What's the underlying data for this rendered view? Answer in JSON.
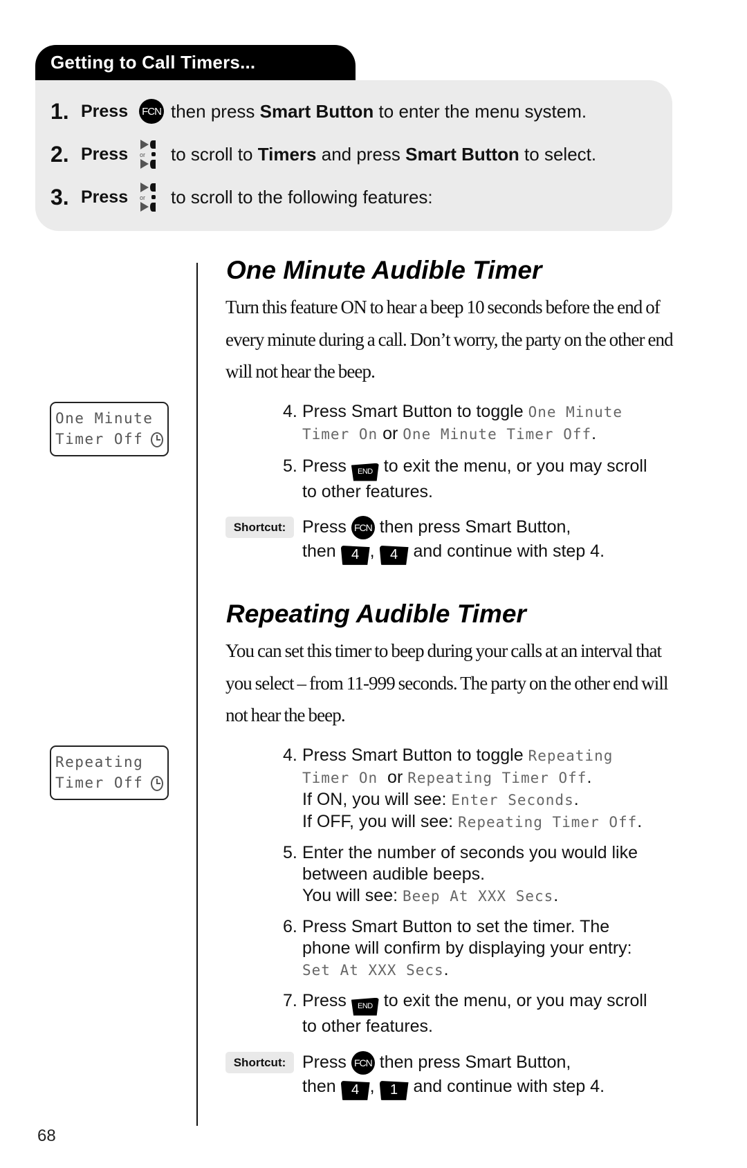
{
  "header": {
    "title": "Getting to Call Timers..."
  },
  "getting_steps": [
    {
      "num": "1.",
      "press": "Press",
      "icon": "fcn-key-icon",
      "icon_label": "FCN",
      "text_before": "then press ",
      "bold1": "Smart Button",
      "text_mid": " to enter the menu system.",
      "bold2": "",
      "text_after": ""
    },
    {
      "num": "2.",
      "press": "Press",
      "icon": "scroll-keys-icon",
      "icon_label": "or",
      "text_before": "to scroll to ",
      "bold1": "Timers",
      "text_mid": " and press ",
      "bold2": "Smart Button",
      "text_after": " to select."
    },
    {
      "num": "3.",
      "press": "Press",
      "icon": "scroll-keys-icon",
      "icon_label": "or",
      "text_before": "to scroll to the following features:",
      "bold1": "",
      "text_mid": "",
      "bold2": "",
      "text_after": ""
    }
  ],
  "sections": [
    {
      "title": "One Minute Audible Timer",
      "paragraph_lines": [
        "Turn this feature ON to hear a beep 10 seconds before the end of",
        "every minute during a call. Don’t worry, the party on the other end",
        "will not hear the beep."
      ],
      "lcd": {
        "line1": "One Minute",
        "line2": "Timer Off",
        "icon": "clock-icon"
      },
      "steps": [
        {
          "num": "4.",
          "line1_text": "Press Smart Button to toggle ",
          "line1_lcd": "One Minute",
          "line2_lcd_a": "Timer On",
          "line2_or": " or ",
          "line2_lcd_b": "One Minute Timer Off",
          "line2_end": "."
        },
        {
          "num": "5.",
          "press": "Press ",
          "key": "END",
          "rest": " to exit the menu, or you may scroll",
          "line2": "to other features."
        }
      ],
      "shortcut": {
        "label": "Shortcut:",
        "press": "Press ",
        "fcn": "FCN",
        "after_fcn": " then press Smart Button,",
        "then": "then ",
        "key1": "4",
        "comma": ",",
        "key2": "4",
        "end": " and continue with step 4."
      }
    },
    {
      "title": "Repeating Audible Timer",
      "paragraph_lines": [
        "You can set this timer to beep during your calls at an interval that",
        "you select – from 11-999 seconds. The party on the other end will",
        "not hear the beep."
      ],
      "lcd": {
        "line1": "Repeating",
        "line2": "Timer Off",
        "icon": "clock-icon"
      },
      "steps": [
        {
          "num": "4.",
          "line1_text": "Press Smart Button to toggle ",
          "line1_lcd": "Repeating",
          "line2_lcd_a": "Timer On",
          "line2_or": "  or ",
          "line2_lcd_b": "Repeating Timer Off",
          "line2_end": ".",
          "line3_text": "If ON, you will see: ",
          "line3_lcd": "Enter Seconds",
          "line3_end": ".",
          "line4_text": "If OFF, you will see: ",
          "line4_lcd": "Repeating Timer Off",
          "line4_end": "."
        },
        {
          "num": "5.",
          "line1": "Enter the number of seconds you would like",
          "line2": "between audible beeps.",
          "line3_text": "You will see: ",
          "line3_lcd": "Beep At XXX Secs",
          "line3_end": "."
        },
        {
          "num": "6.",
          "line1": "Press Smart Button to set the timer. The",
          "line2": "phone will confirm by displaying your entry:",
          "line3_lcd": "Set At XXX Secs",
          "line3_end": "."
        },
        {
          "num": "7.",
          "press": "Press ",
          "key": "END",
          "rest": " to exit the menu, or you may scroll",
          "line2": "to other features."
        }
      ],
      "shortcut": {
        "label": "Shortcut:",
        "press": "Press ",
        "fcn": "FCN",
        "after_fcn": " then press Smart Button,",
        "then": "then ",
        "key1": "4",
        "comma": ",",
        "key2": "1",
        "end": " and continue with step 4."
      }
    }
  ],
  "page_number": "68"
}
